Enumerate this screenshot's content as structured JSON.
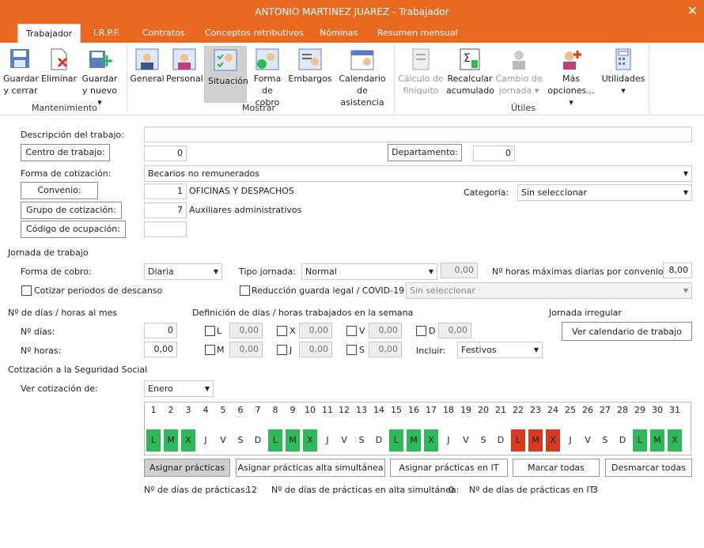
{
  "title": "ANTONIO MARTINEZ JUAREZ - Trabajador",
  "tabs": [
    "Trabajador",
    "I.R.P.F.",
    "Contratos",
    "Conceptos retributivos",
    "Nóminas",
    "Resumen mensual"
  ],
  "ribbon": {
    "mantenimiento": {
      "label": "Mantenimiento",
      "buttons": [
        {
          "l1": "Guardar",
          "l2": "y cerrar"
        },
        {
          "l1": "Eliminar",
          "l2": ""
        },
        {
          "l1": "Guardar",
          "l2": "y nuevo ▾"
        }
      ]
    },
    "mostrar": {
      "label": "Mostrar",
      "buttons": [
        {
          "l1": "General",
          "l2": ""
        },
        {
          "l1": "Personal",
          "l2": ""
        },
        {
          "l1": "Situación",
          "l2": ""
        },
        {
          "l1": "Forma",
          "l2": "de cobro"
        },
        {
          "l1": "Embargos",
          "l2": ""
        },
        {
          "l1": "Calendario",
          "l2": "de asistencia"
        }
      ]
    },
    "utiles": {
      "label": "Útiles",
      "buttons": [
        {
          "l1": "Cálculo de",
          "l2": "finiquito"
        },
        {
          "l1": "Recalcular",
          "l2": "acumulado"
        },
        {
          "l1": "Cambio de",
          "l2": "jornada ▾"
        },
        {
          "l1": "Más",
          "l2": "opciones... ▾"
        },
        {
          "l1": "Utilidades",
          "l2": "▾"
        }
      ]
    }
  },
  "form": {
    "descripcion_label": "Descripción del trabajo:",
    "descripcion_value": "",
    "centro_label": "Centro de trabajo:",
    "centro_value": "0",
    "departamento_label": "Departamento:",
    "departamento_value": "0",
    "forma_cot_label": "Forma de cotización:",
    "forma_cot_value": "Becarios no remunerados",
    "convenio_label": "Convenio:",
    "convenio_num": "1",
    "convenio_text": "OFICINAS Y DESPACHOS",
    "categoria_label": "Categoría:",
    "categoria_value": "Sin seleccionar",
    "grupo_label": "Grupo de cotización:",
    "grupo_num": "7",
    "grupo_text": "Auxiliares administrativos",
    "codigo_label": "Código de ocupación:",
    "codigo_value": ""
  },
  "jornada": {
    "header": "Jornada de trabajo",
    "forma_cobro_label": "Forma de cobro:",
    "forma_cobro_value": "Diaria",
    "tipo_label": "Tipo jornada:",
    "tipo_value": "Normal",
    "tipo_num": "0,00",
    "horas_max_label": "Nº horas máximas diarias por convenio:",
    "horas_max_value": "8,00",
    "cotizar_label": "Cotizar periodos de descanso",
    "reduccion_label": "Reducción guarda legal / COVID-19",
    "reduccion_select": "Sin seleccionar"
  },
  "dias": {
    "header1": "Nº de días / horas al mes",
    "header2": "Definición de días / horas trabajados en la semana",
    "header3": "Jornada irregular",
    "n_dias_label": "Nº días:",
    "n_dias_value": "0",
    "n_horas_label": "Nº horas:",
    "n_horas_value": "0,00",
    "week": [
      {
        "d": "L",
        "v": "0,00"
      },
      {
        "d": "X",
        "v": "0,00"
      },
      {
        "d": "V",
        "v": "0,00"
      },
      {
        "d": "D",
        "v": "0,00"
      },
      {
        "d": "M",
        "v": "0,00"
      },
      {
        "d": "J",
        "v": "0,00"
      },
      {
        "d": "S",
        "v": "0,00"
      }
    ],
    "incluir_label": "Incluir:",
    "incluir_value": "Festivos",
    "ver_calendario": "Ver calendario de trabajo"
  },
  "cotizacion": {
    "header": "Cotización a la Seguridad Social",
    "ver_label": "Ver cotización de:",
    "ver_value": "Enero"
  },
  "calendar": {
    "days": [
      "1",
      "2",
      "3",
      "4",
      "5",
      "6",
      "7",
      "8",
      "9",
      "10",
      "11",
      "12",
      "13",
      "14",
      "15",
      "16",
      "17",
      "18",
      "19",
      "20",
      "21",
      "22",
      "23",
      "24",
      "25",
      "26",
      "27",
      "28",
      "29",
      "30",
      "31"
    ],
    "letters": [
      "L",
      "M",
      "X",
      "J",
      "V",
      "S",
      "D",
      "L",
      "M",
      "X",
      "J",
      "V",
      "S",
      "D",
      "L",
      "M",
      "X",
      "J",
      "V",
      "S",
      "D",
      "L",
      "M",
      "X",
      "J",
      "V",
      "S",
      "D",
      "L",
      "M",
      "X"
    ],
    "status": [
      "g",
      "g",
      "g",
      "",
      "",
      "",
      "",
      "g",
      "g",
      "g",
      "",
      "",
      "",
      "",
      "g",
      "g",
      "g",
      "",
      "",
      "",
      "",
      "r",
      "r",
      "r",
      "",
      "",
      "",
      "",
      "g",
      "g",
      "g"
    ],
    "colors": {
      "green": "#2db85a",
      "red": "#d53a1f"
    }
  },
  "actions": [
    "Asignar prácticas",
    "Asignar prácticas alta simultánea",
    "Asignar prácticas en IT",
    "Marcar todas",
    "Desmarcar todas"
  ],
  "summary": {
    "practicas_label": "Nº de días de prácticas:",
    "practicas_value": "12",
    "alta_label": "Nº de días de prácticas en alta simultánea:",
    "alta_value": "0",
    "it_label": "Nº de días de prácticas en IT:",
    "it_value": "3"
  }
}
